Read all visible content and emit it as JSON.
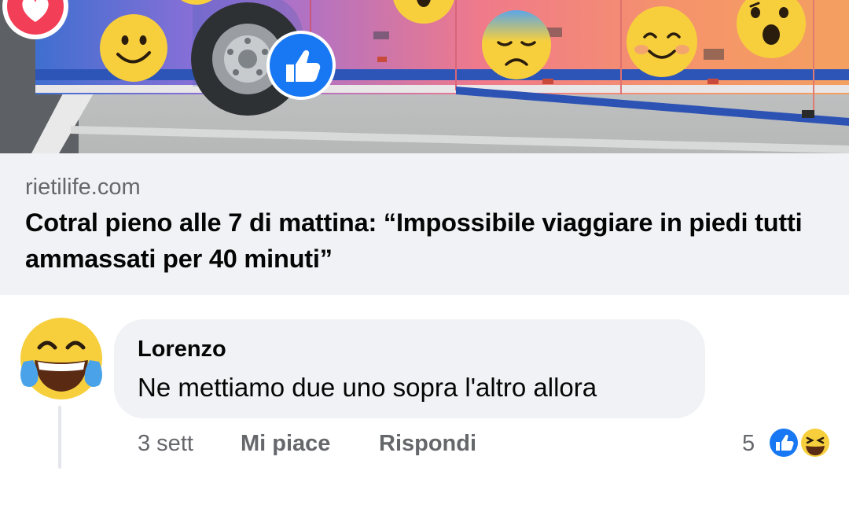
{
  "link_preview": {
    "domain": "rietilife.com",
    "headline": "Cotral pieno alle 7 di mattina: “Impossibile viaggiare in piedi tutti ammassati per 40 minuti”",
    "image_icons": [
      "heart-reaction-icon",
      "like-reaction-icon",
      "smiling-face-emoji",
      "sleepy-face-emoji",
      "blushing-face-emoji",
      "surprised-face-emoji"
    ]
  },
  "comment": {
    "author": "Lorenzo",
    "text": "Ne mettiamo due uno sopra l'altro allora",
    "avatar_icon": "tears-of-joy-emoji",
    "time": "3 sett",
    "like_label": "Mi piace",
    "reply_label": "Rispondi",
    "reaction_count": "5",
    "reaction_icons": [
      "like-reaction-icon",
      "haha-reaction-icon"
    ]
  },
  "colors": {
    "facebook_blue": "#1877f2",
    "bubble_bg": "#f0f2f5",
    "secondary_text": "#65676b",
    "primary_text": "#050505",
    "heart_red": "#f33e58"
  }
}
